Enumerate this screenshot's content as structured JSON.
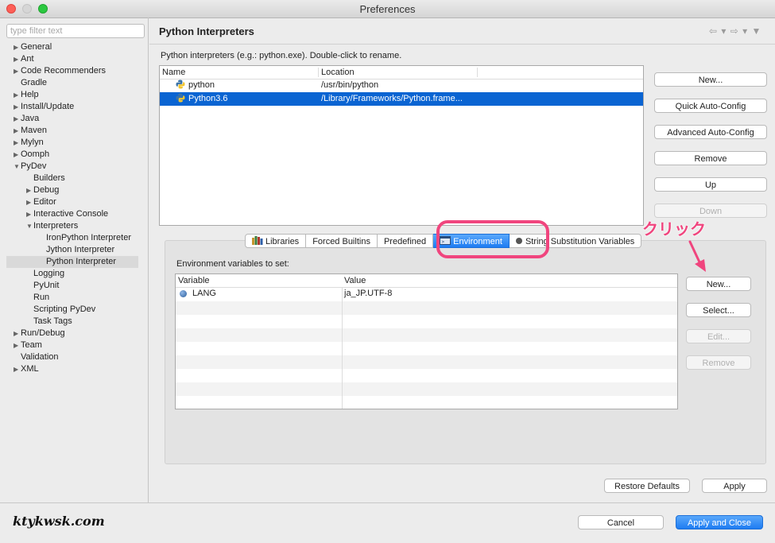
{
  "window": {
    "title": "Preferences"
  },
  "sidebar": {
    "filter_placeholder": "type filter text",
    "items": [
      {
        "label": "General",
        "level": 0,
        "twisty": "▶"
      },
      {
        "label": "Ant",
        "level": 0,
        "twisty": "▶"
      },
      {
        "label": "Code Recommenders",
        "level": 0,
        "twisty": "▶"
      },
      {
        "label": "Gradle",
        "level": 0,
        "twisty": ""
      },
      {
        "label": "Help",
        "level": 0,
        "twisty": "▶"
      },
      {
        "label": "Install/Update",
        "level": 0,
        "twisty": "▶"
      },
      {
        "label": "Java",
        "level": 0,
        "twisty": "▶"
      },
      {
        "label": "Maven",
        "level": 0,
        "twisty": "▶"
      },
      {
        "label": "Mylyn",
        "level": 0,
        "twisty": "▶"
      },
      {
        "label": "Oomph",
        "level": 0,
        "twisty": "▶"
      },
      {
        "label": "PyDev",
        "level": 0,
        "twisty": "▼"
      },
      {
        "label": "Builders",
        "level": 1,
        "twisty": ""
      },
      {
        "label": "Debug",
        "level": 1,
        "twisty": "▶"
      },
      {
        "label": "Editor",
        "level": 1,
        "twisty": "▶"
      },
      {
        "label": "Interactive Console",
        "level": 1,
        "twisty": "▶"
      },
      {
        "label": "Interpreters",
        "level": 1,
        "twisty": "▼"
      },
      {
        "label": "IronPython Interpreter",
        "level": 2,
        "twisty": ""
      },
      {
        "label": "Jython Interpreter",
        "level": 2,
        "twisty": ""
      },
      {
        "label": "Python Interpreter",
        "level": 2,
        "twisty": "",
        "selected": true
      },
      {
        "label": "Logging",
        "level": 1,
        "twisty": ""
      },
      {
        "label": "PyUnit",
        "level": 1,
        "twisty": ""
      },
      {
        "label": "Run",
        "level": 1,
        "twisty": ""
      },
      {
        "label": "Scripting PyDev",
        "level": 1,
        "twisty": ""
      },
      {
        "label": "Task Tags",
        "level": 1,
        "twisty": ""
      },
      {
        "label": "Run/Debug",
        "level": 0,
        "twisty": "▶"
      },
      {
        "label": "Team",
        "level": 0,
        "twisty": "▶"
      },
      {
        "label": "Validation",
        "level": 0,
        "twisty": ""
      },
      {
        "label": "XML",
        "level": 0,
        "twisty": "▶"
      }
    ]
  },
  "page": {
    "title": "Python Interpreters",
    "nav_arrows": "⇦ ▾ ⇨ ▾  ▼",
    "description": "Python interpreters (e.g.: python.exe).   Double-click to rename.",
    "interpreters": {
      "columns": [
        "Name",
        "Location"
      ],
      "rows": [
        {
          "name": "python",
          "location": "/usr/bin/python",
          "selected": false
        },
        {
          "name": "Python3.6",
          "location": "/Library/Frameworks/Python.frame...",
          "selected": true
        }
      ]
    },
    "interpreter_buttons": {
      "new": "New...",
      "quick": "Quick Auto-Config",
      "advanced": "Advanced Auto-Config",
      "remove": "Remove",
      "up": "Up",
      "down": "Down"
    },
    "tabs": [
      "Libraries",
      "Forced Builtins",
      "Predefined",
      "Environment",
      "String Substitution Variables"
    ],
    "active_tab": "Environment",
    "env": {
      "label": "Environment variables to set:",
      "columns": [
        "Variable",
        "Value"
      ],
      "rows": [
        {
          "variable": "LANG",
          "value": "ja_JP.UTF-8"
        }
      ],
      "buttons": {
        "new": "New...",
        "select": "Select...",
        "edit": "Edit...",
        "remove": "Remove"
      }
    },
    "restore_defaults": "Restore Defaults",
    "apply": "Apply"
  },
  "footer": {
    "cancel": "Cancel",
    "apply_close": "Apply and Close"
  },
  "annotation": {
    "text": "クリック",
    "color": "#f0457e"
  },
  "watermark": "ktykwsk.com",
  "colors": {
    "selection": "#0a64d2",
    "primary_button": "#1e7cf2"
  }
}
